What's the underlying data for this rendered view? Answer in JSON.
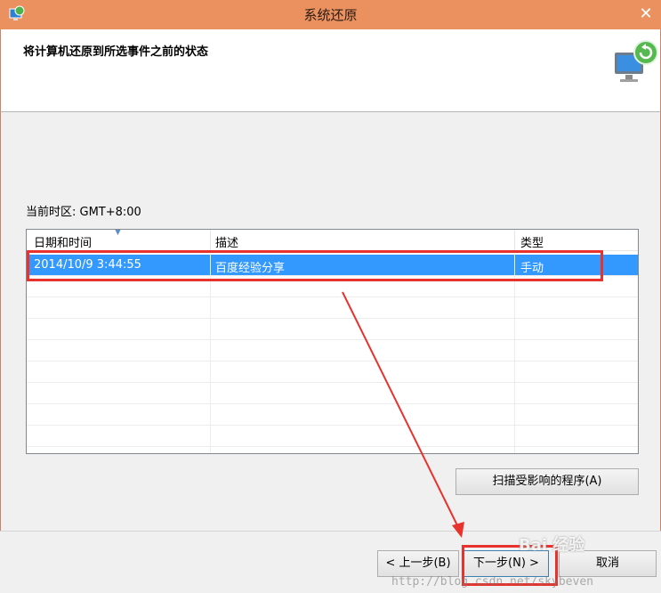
{
  "window": {
    "title": "系统还原",
    "close_glyph": "✕"
  },
  "header": {
    "title": "将计算机还原到所选事件之前的状态",
    "icon": "system-restore-monitor-icon"
  },
  "timezone": {
    "label": "当前时区: GMT+8:00"
  },
  "list": {
    "columns": [
      "日期和时间",
      "描述",
      "类型"
    ],
    "rows": [
      {
        "date": "2014/10/9 3:44:55",
        "description": "百度经验分享",
        "type": "手动",
        "selected": true
      }
    ]
  },
  "buttons": {
    "scan": "扫描受影响的程序(A)",
    "back": "< 上一步(B)",
    "next": "下一步(N) >",
    "cancel": "取消"
  },
  "watermark": {
    "brand": "Bai 经验",
    "url": "http://blog.csdn.net/skybeven"
  },
  "colors": {
    "titlebar": "#ea915f",
    "selection": "#3399ff",
    "highlight": "#e8322e"
  }
}
